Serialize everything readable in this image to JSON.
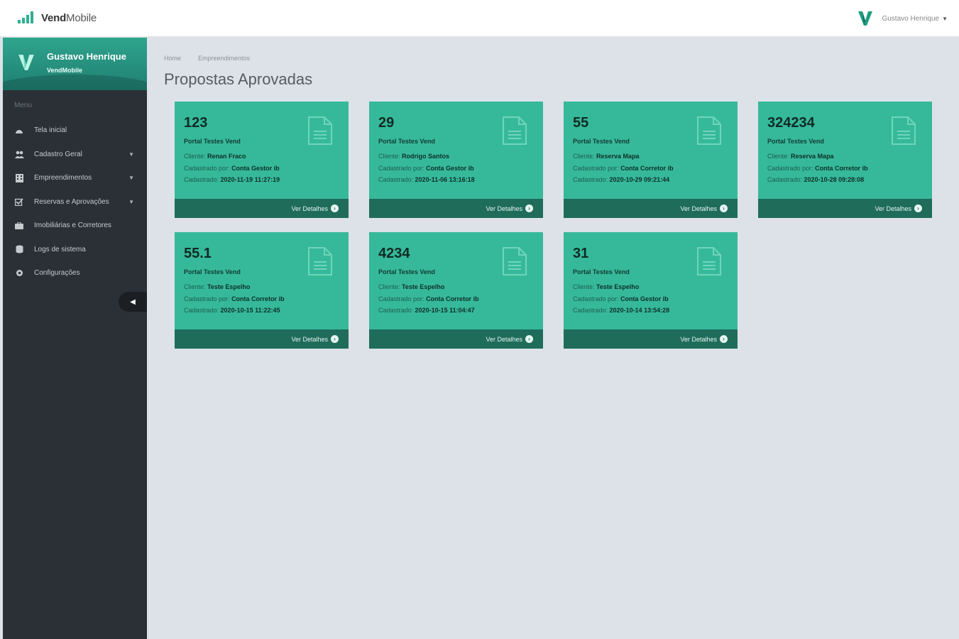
{
  "app": {
    "brand_bold": "Vend",
    "brand_light": "Mobile",
    "user_name": "Gustavo Henrique",
    "accent": "#36b99a",
    "sidebar_bg": "#2a3036"
  },
  "sidebar": {
    "profile_name": "Gustavo Henrique",
    "profile_org": "VendMobile",
    "menu_title": "Menu",
    "items": [
      {
        "label": "Tela inicial",
        "icon": "dashboard-icon",
        "has_submenu": false
      },
      {
        "label": "Cadastro Geral",
        "icon": "users-icon",
        "has_submenu": true
      },
      {
        "label": "Empreendimentos",
        "icon": "building-icon",
        "has_submenu": true
      },
      {
        "label": "Reservas e Aprovações",
        "icon": "check-square-icon",
        "has_submenu": true
      },
      {
        "label": "Imobiliárias e Corretores",
        "icon": "briefcase-icon",
        "has_submenu": false
      },
      {
        "label": "Logs de sistema",
        "icon": "database-icon",
        "has_submenu": false
      },
      {
        "label": "Configurações",
        "icon": "gear-icon",
        "has_submenu": false
      }
    ]
  },
  "breadcrumb": [
    "Home",
    "Empreendimentos"
  ],
  "page_title": "Propostas Aprovadas",
  "cards": [
    {
      "number": "123",
      "project": "Portal Testes Vend",
      "client_label": "Cliente:",
      "client": "Renan Fraco",
      "by_label": "Cadastrado por:",
      "by": "Conta Gestor ib",
      "date_label": "Cadastrado:",
      "date": "2020-11-19 11:27:19",
      "footer": "Ver Detalhes"
    },
    {
      "number": "29",
      "project": "Portal Testes Vend",
      "client_label": "Cliente:",
      "client": "Rodrigo Santos",
      "by_label": "Cadastrado por:",
      "by": "Conta Gestor ib",
      "date_label": "Cadastrado:",
      "date": "2020-11-06 13:16:18",
      "footer": "Ver Detalhes"
    },
    {
      "number": "55",
      "project": "Portal Testes Vend",
      "client_label": "Cliente:",
      "client": "Reserva Mapa",
      "by_label": "Cadastrado por:",
      "by": "Conta Corretor ib",
      "date_label": "Cadastrado:",
      "date": "2020-10-29 09:21:44",
      "footer": "Ver Detalhes"
    },
    {
      "number": "324234",
      "project": "Portal Testes Vend",
      "client_label": "Cliente:",
      "client": "Reserva Mapa",
      "by_label": "Cadastrado por:",
      "by": "Conta Corretor ib",
      "date_label": "Cadastrado:",
      "date": "2020-10-28 09:28:08",
      "footer": "Ver Detalhes"
    },
    {
      "number": "55.1",
      "project": "Portal Testes Vend",
      "client_label": "Cliente:",
      "client": "Teste Espelho",
      "by_label": "Cadastrado por:",
      "by": "Conta Corretor ib",
      "date_label": "Cadastrado:",
      "date": "2020-10-15 11:22:45",
      "footer": "Ver Detalhes"
    },
    {
      "number": "4234",
      "project": "Portal Testes Vend",
      "client_label": "Cliente:",
      "client": "Teste Espelho",
      "by_label": "Cadastrado por:",
      "by": "Conta Corretor ib",
      "date_label": "Cadastrado:",
      "date": "2020-10-15 11:04:47",
      "footer": "Ver Detalhes"
    },
    {
      "number": "31",
      "project": "Portal Testes Vend",
      "client_label": "Cliente:",
      "client": "Teste Espelho",
      "by_label": "Cadastrado por:",
      "by": "Conta Gestor ib",
      "date_label": "Cadastrado:",
      "date": "2020-10-14 13:54:28",
      "footer": "Ver Detalhes"
    }
  ]
}
